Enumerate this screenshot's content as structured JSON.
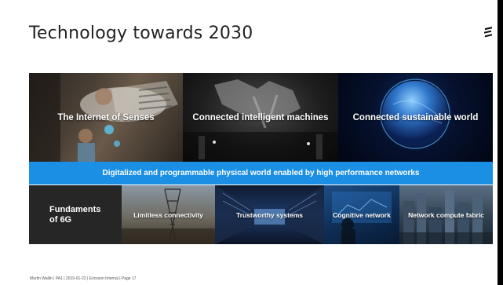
{
  "slide": {
    "title": "Technology towards 2030",
    "top_panels": [
      {
        "label": "The Internet of Senses"
      },
      {
        "label": "Connected intelligent machines"
      },
      {
        "label": "Connected sustainable world"
      }
    ],
    "band_text": "Digitalized and programmable physical world enabled by high performance networks",
    "bottom_panels": [
      {
        "label_line1": "Fundaments",
        "label_line2": "of 6G"
      },
      {
        "label": "Limitless connectivity"
      },
      {
        "label": "Trustworthy systems"
      },
      {
        "label": "Cognitive network"
      },
      {
        "label": "Network compute fabric"
      }
    ],
    "footer": "Martin Wallin  |  PA1  |  2019-01-22  |  Ericsson Internal  |  Page 17"
  },
  "colors": {
    "band_blue": "#1a8fe3",
    "background": "#ffffff",
    "title_text": "#222222",
    "fundaments_bg": "#262626"
  },
  "icons": {
    "logo": "ericsson-logo-icon"
  }
}
